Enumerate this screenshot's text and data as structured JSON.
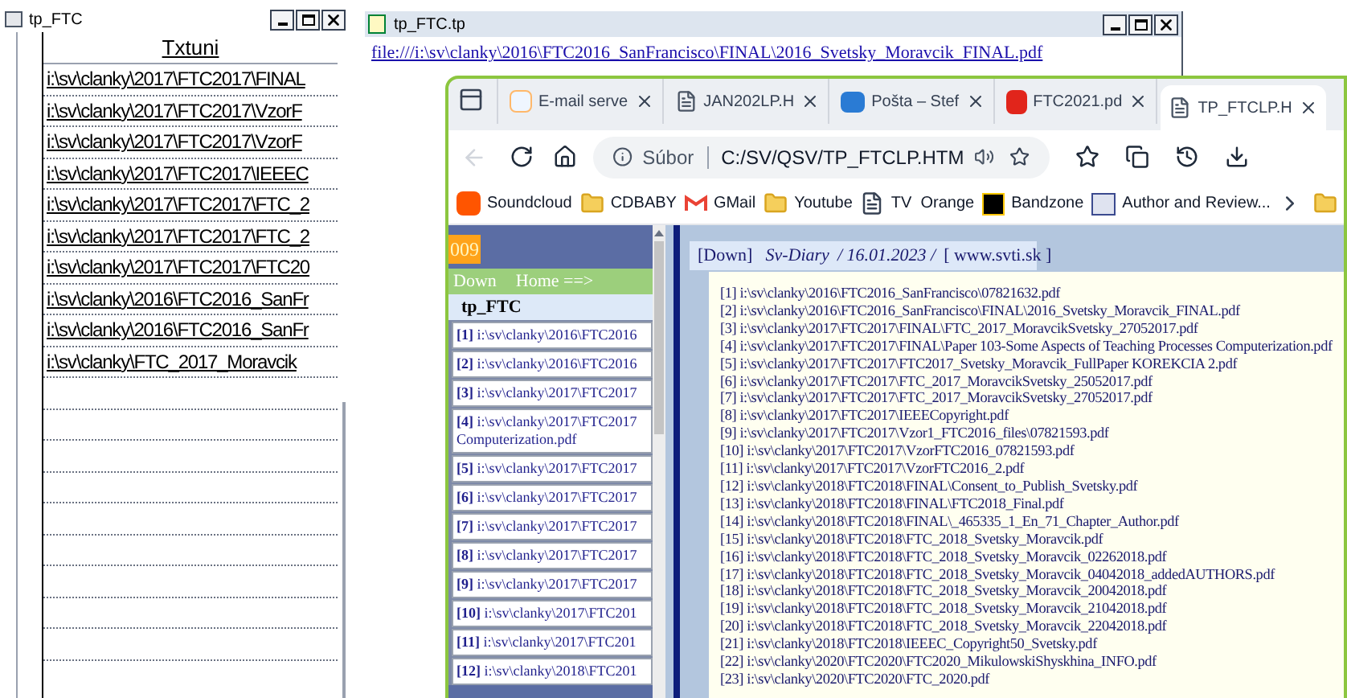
{
  "table_window": {
    "title": "tp_FTC",
    "column_header": "Txtuni",
    "rows": [
      "i:\\sv\\clanky\\2017\\FTC2017\\FINAL",
      "i:\\sv\\clanky\\2017\\FTC2017\\VzorF",
      "i:\\sv\\clanky\\2017\\FTC2017\\VzorF",
      "i:\\sv\\clanky\\2017\\FTC2017\\IEEEC",
      "i:\\sv\\clanky\\2017\\FTC2017\\FTC_2",
      "i:\\sv\\clanky\\2017\\FTC2017\\FTC_2",
      "i:\\sv\\clanky\\2017\\FTC2017\\FTC20",
      "i:\\sv\\clanky\\2016\\FTC2016_SanFr",
      "i:\\sv\\clanky\\2016\\FTC2016_SanFr",
      "i:\\sv\\clanky\\FTC_2017_Moravcik"
    ]
  },
  "link_window": {
    "title": "tp_FTC.tp",
    "link": "file:///i:\\sv\\clanky\\2016\\FTC2016_SanFrancisco\\FINAL\\2016_Svetsky_Moravcik_FINAL.pdf"
  },
  "browser": {
    "tabs": [
      {
        "label": "E-mail serve",
        "kind": "logo",
        "selected": false
      },
      {
        "label": "JAN202LP.H",
        "kind": "page",
        "selected": false
      },
      {
        "label": "Pošta – Stef",
        "kind": "mail",
        "selected": false
      },
      {
        "label": "FTC2021.pd",
        "kind": "pdf",
        "selected": false
      },
      {
        "label": "TP_FTCLP.H",
        "kind": "page",
        "selected": true
      }
    ],
    "address": {
      "prefix": "Súbor",
      "url": "C:/SV/QSV/TP_FTCLP.HTM"
    },
    "bookmarks": [
      {
        "label": "Soundcloud",
        "kind": "cloud"
      },
      {
        "label": "CDBABY",
        "kind": "folder"
      },
      {
        "label": "GMail",
        "kind": "gmail"
      },
      {
        "label": "Youtube",
        "kind": "folder"
      },
      {
        "label": "TV  Orange",
        "kind": "page"
      },
      {
        "label": "Bandzone",
        "kind": "bz"
      },
      {
        "label": "Author and Review...",
        "kind": "sn"
      }
    ]
  },
  "page": {
    "badge": "009",
    "nav": [
      "Down",
      "Home ==>"
    ],
    "heading": "tp_FTC",
    "links": [
      {
        "number": "[1]",
        "text": "i:\\sv\\clanky\\2016\\FTC2016"
      },
      {
        "number": "[2]",
        "text": "i:\\sv\\clanky\\2016\\FTC2016"
      },
      {
        "number": "[3]",
        "text": "i:\\sv\\clanky\\2017\\FTC2017"
      },
      {
        "number": "[4]",
        "text": "i:\\sv\\clanky\\2017\\FTC2017",
        "continuation": "Computerization.pdf"
      },
      {
        "number": "[5]",
        "text": "i:\\sv\\clanky\\2017\\FTC2017"
      },
      {
        "number": "[6]",
        "text": "i:\\sv\\clanky\\2017\\FTC2017"
      },
      {
        "number": "[7]",
        "text": "i:\\sv\\clanky\\2017\\FTC2017"
      },
      {
        "number": "[8]",
        "text": "i:\\sv\\clanky\\2017\\FTC2017"
      },
      {
        "number": "[9]",
        "text": "i:\\sv\\clanky\\2017\\FTC2017"
      },
      {
        "number": "[10]",
        "text": "i:\\sv\\clanky\\2017\\FTC201"
      },
      {
        "number": "[11]",
        "text": "i:\\sv\\clanky\\2017\\FTC201"
      },
      {
        "number": "[12]",
        "text": "i:\\sv\\clanky\\2018\\FTC201"
      }
    ],
    "diary_header": {
      "down": "[Down]",
      "title": "Sv-Diary",
      "date": "/ 16.01.2023 /",
      "site": "[ www.svti.sk ]"
    },
    "entries": [
      "[1] i:\\sv\\clanky\\2016\\FTC2016_SanFrancisco\\07821632.pdf",
      "[2] i:\\sv\\clanky\\2016\\FTC2016_SanFrancisco\\FINAL\\2016_Svetsky_Moravcik_FINAL.pdf",
      "[3] i:\\sv\\clanky\\2017\\FTC2017\\FINAL\\FTC_2017_MoravcikSvetsky_27052017.pdf",
      "[4] i:\\sv\\clanky\\2017\\FTC2017\\FINAL\\Paper 103-Some Aspects of Teaching Processes Computerization.pdf",
      "[5] i:\\sv\\clanky\\2017\\FTC2017\\FTC2017_Svetsky_Moravcik_FullPaper KOREKCIA 2.pdf",
      "[6] i:\\sv\\clanky\\2017\\FTC2017\\FTC_2017_MoravcikSvetsky_25052017.pdf",
      "[7] i:\\sv\\clanky\\2017\\FTC2017\\FTC_2017_MoravcikSvetsky_27052017.pdf",
      "[8] i:\\sv\\clanky\\2017\\FTC2017\\IEEECopyright.pdf",
      "[9] i:\\sv\\clanky\\2017\\FTC2017\\Vzor1_FTC2016_files\\07821593.pdf",
      "[10] i:\\sv\\clanky\\2017\\FTC2017\\VzorFTC2016_07821593.pdf",
      "[11] i:\\sv\\clanky\\2017\\FTC2017\\VzorFTC2016_2.pdf",
      "[12] i:\\sv\\clanky\\2018\\FTC2018\\FINAL\\Consent_to_Publish_Svetsky.pdf",
      "[13] i:\\sv\\clanky\\2018\\FTC2018\\FINAL\\FTC2018_Final.pdf",
      "[14] i:\\sv\\clanky\\2018\\FTC2018\\FINAL\\_465335_1_En_71_Chapter_Author.pdf",
      "[15] i:\\sv\\clanky\\2018\\FTC2018\\FTC_2018_Svetsky_Moravcik.pdf",
      "[16] i:\\sv\\clanky\\2018\\FTC2018\\FTC_2018_Svetsky_Moravcik_02262018.pdf",
      "[17] i:\\sv\\clanky\\2018\\FTC2018\\FTC_2018_Svetsky_Moravcik_04042018_addedAUTHORS.pdf",
      "[18] i:\\sv\\clanky\\2018\\FTC2018\\FTC_2018_Svetsky_Moravcik_20042018.pdf",
      "[19] i:\\sv\\clanky\\2018\\FTC2018\\FTC_2018_Svetsky_Moravcik_21042018.pdf",
      "[20] i:\\sv\\clanky\\2018\\FTC2018\\FTC_2018_Svetsky_Moravcik_22042018.pdf",
      "[21] i:\\sv\\clanky\\2018\\FTC2018\\IEEEC_Copyright50_Svetsky.pdf",
      "[22] i:\\sv\\clanky\\2020\\FTC2020\\FTC2020_MikulowskiShyskhina_INFO.pdf",
      "[23] i:\\sv\\clanky\\2020\\FTC2020\\FTC_2020.pdf"
    ]
  }
}
